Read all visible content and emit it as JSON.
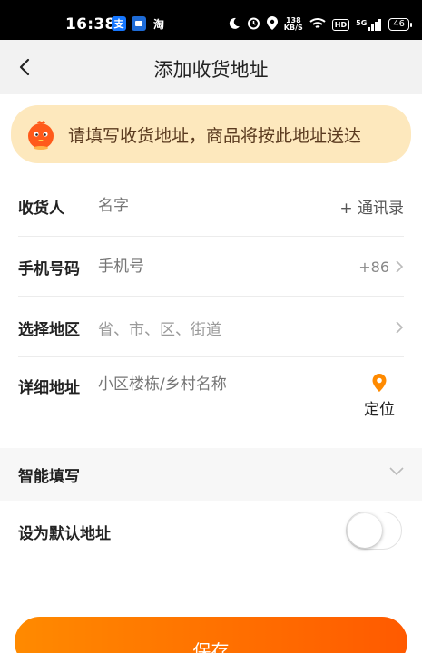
{
  "status_bar": {
    "time": "16:38",
    "app_icons": [
      "alipay-icon",
      "app-icon",
      "taobao-icon"
    ],
    "taobao_label": "淘",
    "alipay_label": "支",
    "net_speed_value": "138",
    "net_speed_unit": "KB/S",
    "hd_label": "HD",
    "signal_label": "5G",
    "battery": "46"
  },
  "header": {
    "title": "添加收货地址",
    "back_icon": "chevron-left-icon"
  },
  "notice": {
    "text": "请填写收货地址，商品将按此地址送达",
    "mascot_icon": "mascot-icon"
  },
  "form": {
    "recipient": {
      "label": "收货人",
      "placeholder": "名字",
      "contacts_label": "+ 通讯录"
    },
    "phone": {
      "label": "手机号码",
      "placeholder": "手机号",
      "country_code": "+86"
    },
    "region": {
      "label": "选择地区",
      "placeholder": "省、市、区、街道"
    },
    "address": {
      "label": "详细地址",
      "placeholder": "小区楼栋/乡村名称",
      "locate_label": "定位"
    }
  },
  "smart_fill": {
    "label": "智能填写"
  },
  "default_address": {
    "label": "设为默认地址",
    "enabled": false
  },
  "save_button": {
    "label": "保存"
  },
  "colors": {
    "accent": "#ff6a00",
    "notice_bg": "#fde8bd",
    "notice_text": "#5a3a1f",
    "location_pin": "#ff8a00"
  }
}
